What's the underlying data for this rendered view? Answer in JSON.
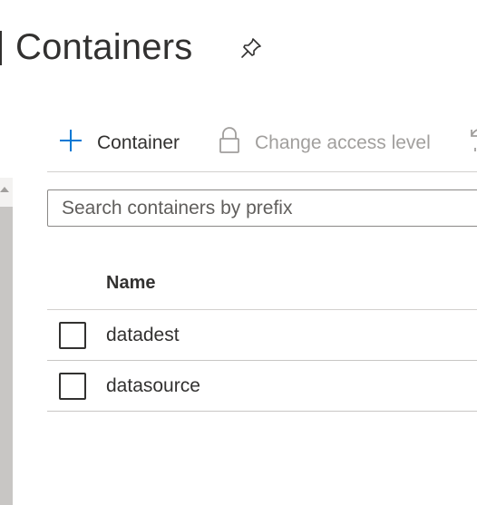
{
  "header": {
    "title": "Containers",
    "pin_icon": "pin-icon"
  },
  "toolbar": {
    "add_label": "Container",
    "add_icon": "plus-icon",
    "access_label": "Change access level",
    "access_icon": "lock-icon",
    "access_enabled": false
  },
  "search": {
    "placeholder": "Search containers by prefix",
    "value": ""
  },
  "table": {
    "columns": [
      "Name"
    ],
    "rows": [
      {
        "name": "datadest",
        "checked": false
      },
      {
        "name": "datasource",
        "checked": false
      }
    ]
  },
  "colors": {
    "accent": "#0078d4",
    "text": "#323130",
    "disabled_text": "#a19f9d",
    "divider": "#d2d0ce"
  }
}
